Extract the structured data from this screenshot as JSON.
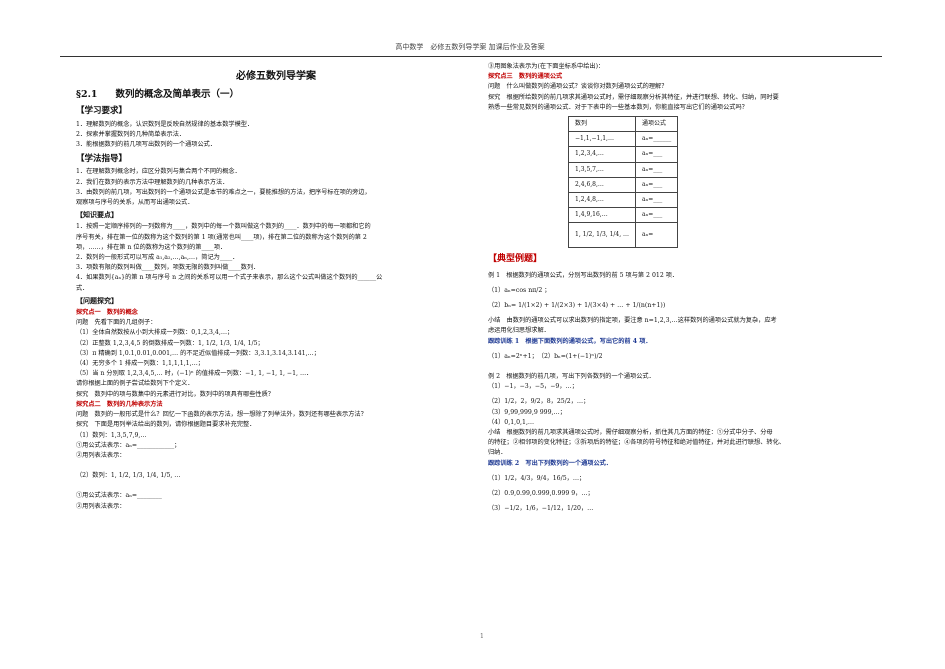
{
  "header": "高中数学　必修五数列导学案 加课后作业及答案",
  "page_number": "1",
  "left": {
    "title": "必修五数列导学案",
    "section_num": "§2.1",
    "section_title": "数列的概念及简单表示（一）",
    "heading_goals": "【学习要求】",
    "goals": [
      "1．理解数列的概念，认识数列是反映自然规律的基本数学模型．",
      "2．探索并掌握数列的几种简单表示法．",
      "3．能根据数列的前几项写出数列的一个通项公式．"
    ],
    "heading_guide": "【学法指导】",
    "guide": [
      "1．在理解数列概念时，应区分数列与集合两个不同的概念．",
      "2．我们在数列的表示方法中理解数列的几种表示方法．",
      "3．由数列的前几项，写出数列的一个通项公式是本节的难点之一，要能推想的方法，把序号标在项的旁边，",
      "观察项与序号的关系，从而写出通项公式．"
    ],
    "heading_knowledge": "【知识要点】",
    "knowledge": [
      "1．按照一定顺序排列的一列数称为____，数列中的每一个数叫做这个数列的____．数列中的每一项都和它的",
      "序号有关，排在第一位的数称为这个数列的第 1 项(通常也叫____项)，排在第二位的数称为这个数列的第 2",
      "项，……，排在第 n 位的数称为这个数列的第____项．",
      "2．数列的一般形式可以写成 a₁,a₂,…,aₙ,…，简记为____．",
      "3．项数有限的数列叫做____数列，项数无限的数列叫做____数列．",
      "4．如果数列{aₙ}的第 n 项与序号 n 之间的关系可以用一个式子来表示，那么这个公式叫做这个数列的______公",
      "式．"
    ],
    "heading_inquiry": "【问题探究】",
    "inquiry1_title": "探究点一　数列的概念",
    "inquiry1_q": "问题　先看下面的几组例子：",
    "inquiry1_items": [
      "（1）全体自然数按从小到大排成一列数：0,1,2,3,4,…；",
      "（2）正整数 1,2,3,4,5 的倒数排成一列数：1, 1/2, 1/3, 1/4, 1/5；",
      "（3）π 精确到 1,0.1,0.01,0.001,… 的不足近似值排成一列数：3,3.1,3.14,3.141,…；",
      "（4）无穷多个 1 排成一列数：1,1,1,1,1,…；",
      "（5）当 n 分别取 1,2,3,4,5,… 时，(−1)ⁿ 的值排成一列数：−1, 1, −1, 1, −1, …．"
    ],
    "inquiry1_ask": "请你根据上面的例子尝试给数列下个定义．",
    "inquiry1_explore": "探究　数列中的项与数集中的元素进行对比，数列中的项具有哪些性质？",
    "inquiry2_title": "探究点二　数列的几种表示方法",
    "inquiry2_q": "问题　数列的一般形式是什么？回忆一下函数的表示方法，想一想除了列举法外，数列还有哪些表示方法？",
    "inquiry2_explore": "探究　下面是用列举法给出的数列，请你根据题目要求补充完整．",
    "inquiry2_items": [
      "（1）数列：1,3,5,7,9,…",
      "①用公式法表示：aₙ=____________；",
      "②用列表法表示：",
      "（2）数列：1, 1/2, 1/3, 1/4, 1/5, …",
      "①用公式法表示：aₙ=________",
      "②用列表法表示："
    ]
  },
  "right": {
    "top_items": [
      "③用图象法表示为(在下面坐标系中给出)："
    ],
    "inquiry3_title": "探究点三　数列的通项公式",
    "inquiry3_q": "问题　什么叫做数列的通项公式？谈谈你对数列通项公式的理解？",
    "inquiry3_explore": [
      "探究　根据所给数列的前几项求其通项公式时，需仔细观察分析其特征，并进行联想、转化、归纳，同时要",
      "熟悉一些常见数列的通项公式．对于下表中的一些基本数列，你能直接写出它们的通项公式吗？"
    ],
    "table_headers": [
      "数列",
      "通项公式"
    ],
    "table_rows": [
      [
        "−1,1,−1,1,…",
        "aₙ=______"
      ],
      [
        "1,2,3,4,…",
        "aₙ=___"
      ],
      [
        "1,3,5,7,…",
        "aₙ=___"
      ],
      [
        "2,4,6,8,…",
        "aₙ=___"
      ],
      [
        "1,2,4,8,…",
        "aₙ=___"
      ],
      [
        "1,4,9,16,…",
        "aₙ=___"
      ],
      [
        "1, 1/2, 1/3, 1/4, …",
        "aₙ="
      ]
    ],
    "heading_examples": "【典型例题】",
    "examples": [
      "例 1　根据数列的通项公式，分别写出数列的前 5 项与第 2 012 项．",
      "（1）aₙ=cos nπ/2 ；",
      "（2）bₙ= 1/(1×2) + 1/(2×3) + 1/(3×4) + … + 1/(n(n+1))",
      "小结　由数列的通项公式可以求出数列的指定项，要注意 n=1,2,3,…这样数列的通项公式就为复杂，应考",
      "虑运用化归思想求解．",
      "跟踪训练 1　根据下面数列的通项公式，写出它的前 4 项．",
      "（1）aₙ=2ⁿ+1；　（2）bₙ=(1+(−1)ⁿ)/2",
      "例 2　根据数列的前几项，写出下列各数列的一个通项公式．",
      "（1）−1，−3，−5，−9，…；",
      "（2）1/2，2，9/2，8，25/2，…；",
      "（3）9,99,999,9 999,…；",
      "（4）0,1,0,1,…",
      "小结　根据数列的前几项求其通项公式时，需仔细观察分析，抓住其几方面的特征：①分式中分子、分母",
      "的特征；②相邻项的变化特征；③拆项后的特征；④各项的符号特征和绝对值特征，并对此进行联想、转化、",
      "归纳．",
      "跟踪训练 2　写出下列数列的一个通项公式．",
      "（1）1/2，4/3，9/4，16/5，…；",
      "（2）0.9,0.99,0.999,0.999 9，…；",
      "（3）−1/2，1/6，−1/12，1/20，…"
    ]
  }
}
